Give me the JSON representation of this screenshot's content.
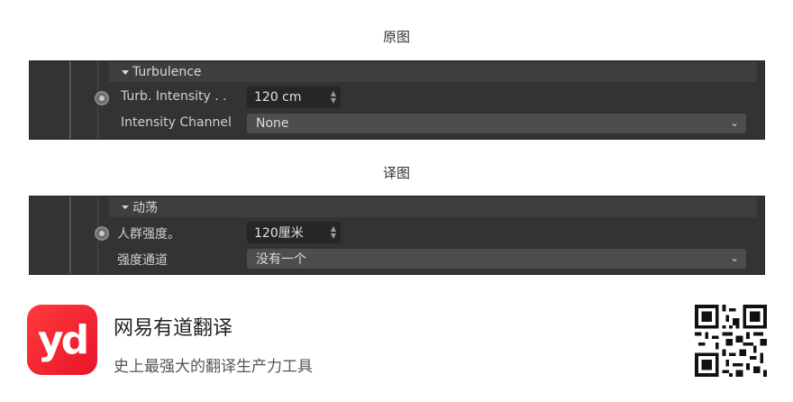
{
  "original": {
    "caption": "原图",
    "section_title": "Turbulence",
    "row1_label": "Turb. Intensity . .",
    "row1_value": "120 cm",
    "row2_label": "Intensity Channel",
    "row2_value": "None"
  },
  "translated": {
    "caption": "译图",
    "section_title": "动荡",
    "row1_label": "人群强度。",
    "row1_value": "120厘米",
    "row2_label": "强度通道",
    "row2_value": "没有一个"
  },
  "brand": {
    "logo_text": "yd",
    "name": "网易有道翻译",
    "slogan": "史上最强大的翻译生产力工具",
    "logo_color": "#ee1c2e"
  },
  "icons": {
    "collapse": "triangle-down-icon",
    "radio": "radio-icon",
    "spinner": "spinner-arrows-icon",
    "dropdown": "chevron-down-icon",
    "qr": "qr-code-icon"
  }
}
